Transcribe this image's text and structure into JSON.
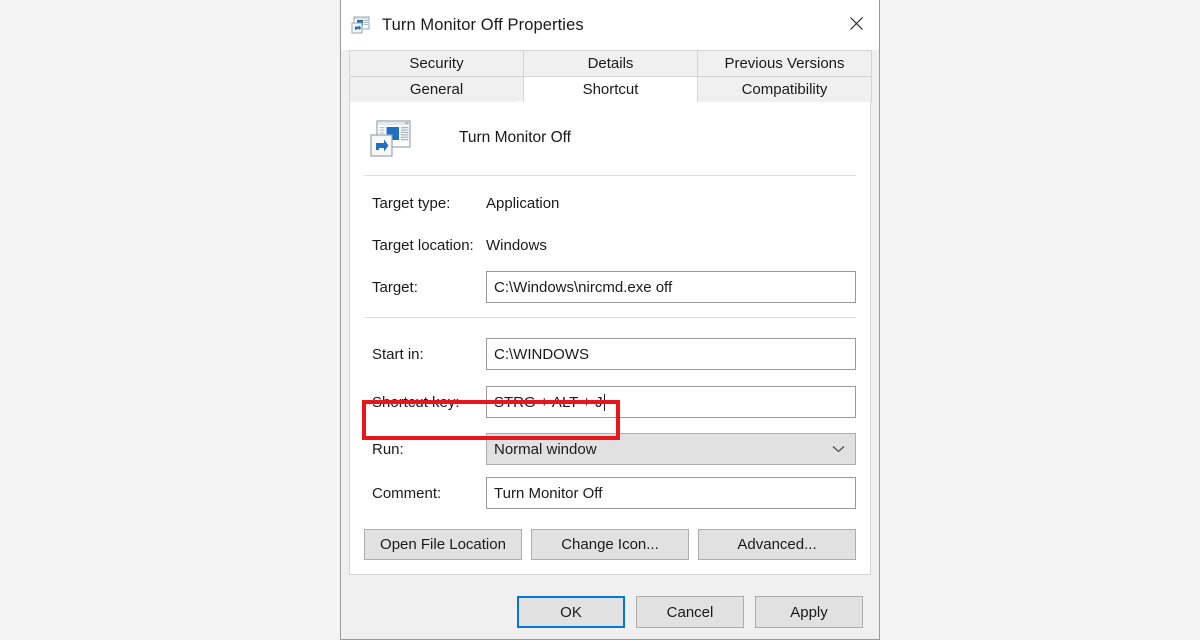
{
  "window": {
    "title": "Turn Monitor Off Properties",
    "icon": "shortcut-application-icon",
    "close_label": "close-icon"
  },
  "tabs": {
    "row1": [
      {
        "label": "Security",
        "active": false
      },
      {
        "label": "Details",
        "active": false
      },
      {
        "label": "Previous Versions",
        "active": false
      }
    ],
    "row2": [
      {
        "label": "General",
        "active": false
      },
      {
        "label": "Shortcut",
        "active": true
      },
      {
        "label": "Compatibility",
        "active": false
      }
    ]
  },
  "shortcut": {
    "app_name": "Turn Monitor Off",
    "app_icon": "shortcut-application-icon",
    "fields": {
      "target_type_label": "Target type:",
      "target_type_value": "Application",
      "target_location_label": "Target location:",
      "target_location_value": "Windows",
      "target_label": "Target:",
      "target_value": "C:\\Windows\\nircmd.exe off",
      "start_in_label": "Start in:",
      "start_in_value": "C:\\WINDOWS",
      "shortcut_key_label": "Shortcut key:",
      "shortcut_key_value": "STRG + ALT + J",
      "run_label": "Run:",
      "run_value": "Normal window",
      "comment_label": "Comment:",
      "comment_value": "Turn Monitor Off"
    },
    "buttons": {
      "open_file_location": "Open File Location",
      "change_icon": "Change Icon...",
      "advanced": "Advanced..."
    }
  },
  "footer": {
    "ok": "OK",
    "cancel": "Cancel",
    "apply": "Apply"
  },
  "annotation": {
    "type": "highlight-rectangle",
    "color": "#e8161a",
    "targets": "shortcut-key-row"
  }
}
